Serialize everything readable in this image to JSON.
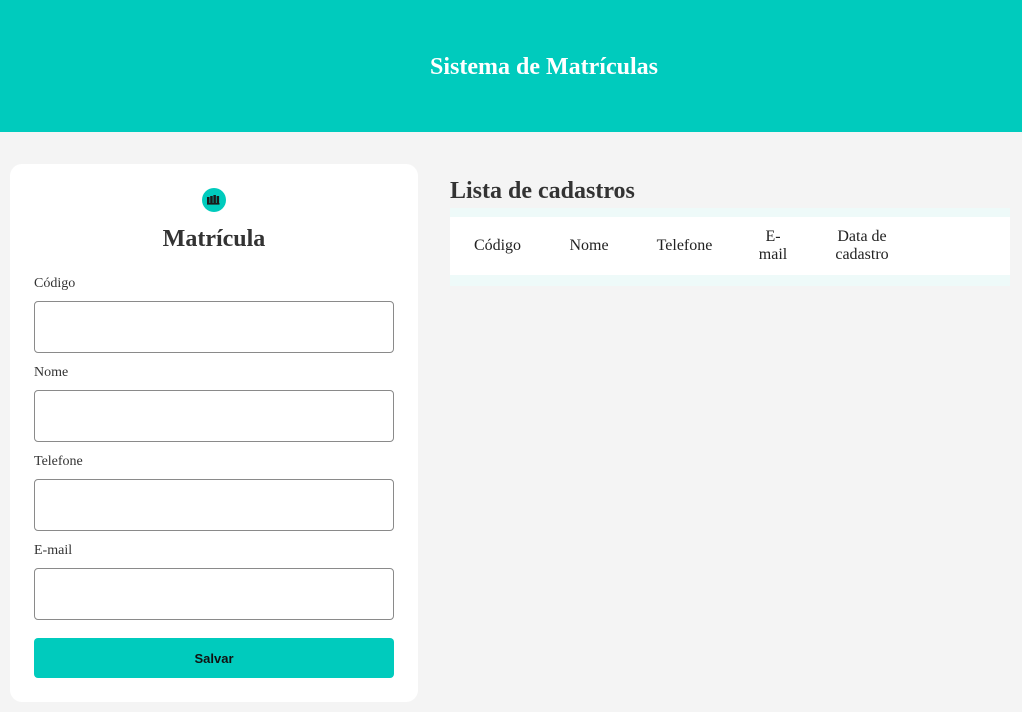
{
  "header": {
    "title": "Sistema de Matrículas"
  },
  "form": {
    "title": "Matrícula",
    "logo_icon": "school-logo-icon",
    "fields": [
      {
        "label": "Código",
        "value": "",
        "placeholder": ""
      },
      {
        "label": "Nome",
        "value": "",
        "placeholder": ""
      },
      {
        "label": "Telefone",
        "value": "",
        "placeholder": ""
      },
      {
        "label": "E-mail",
        "value": "",
        "placeholder": ""
      }
    ],
    "save_label": "Salvar"
  },
  "list": {
    "title": "Lista de cadastros",
    "columns": [
      "Código",
      "Nome",
      "Telefone",
      "E-\nmail",
      "Data de\ncadastro"
    ],
    "rows": []
  },
  "colors": {
    "accent": "#00cbbd",
    "background": "#f4f4f4",
    "card": "#ffffff"
  }
}
